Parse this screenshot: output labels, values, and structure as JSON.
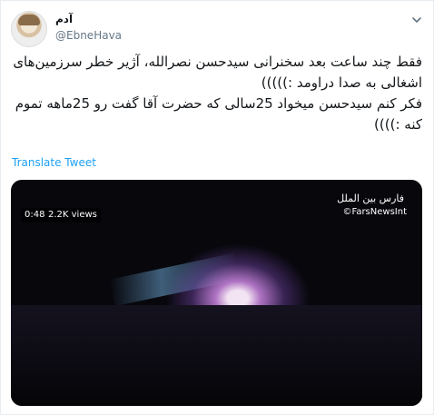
{
  "tweet": {
    "display_name": "آدم",
    "handle": "@EbneHava",
    "text_line1": "فقط چند ساعت بعد سخنرانی سیدحسن نصرالله، آژیر خطر سرزمین‌های اشغالی به صدا دراومد :)))))",
    "text_line2": "فکر کنم سیدحسن میخواد 25سالی که حضرت آقا گفت رو 25ماهه تموم کنه :))))",
    "translate_label": "Translate Tweet"
  },
  "video": {
    "watermark_ar": "فارس بین الملل",
    "watermark_en": "©FarsNewsInt",
    "duration": "0:48",
    "views": "2.2K views"
  },
  "icons": {
    "menu": "chevron-down-icon",
    "avatar": "avatar-image"
  },
  "colors": {
    "link": "#1da1f2",
    "secondary_text": "#657786",
    "primary_text": "#14171a"
  }
}
